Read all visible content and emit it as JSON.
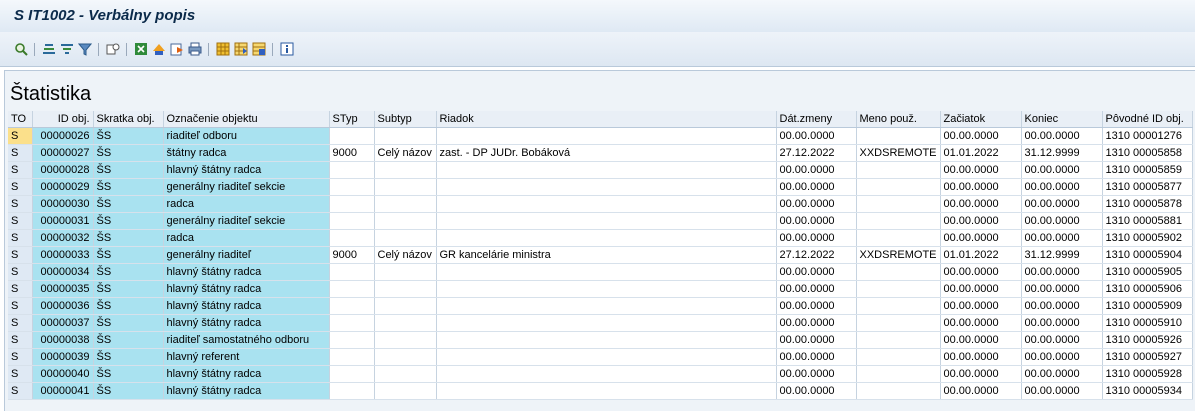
{
  "window": {
    "title": "S IT1002 - Verbálny popis"
  },
  "toolbar": {
    "icons": [
      "details-icon",
      "sort-ascending-icon",
      "filter-icon",
      "filter-off-icon",
      "total-icon",
      "excel-export-icon",
      "transport-icon",
      "save-file-icon",
      "print-icon",
      "layout-icon",
      "change-layout-icon",
      "save-layout-icon",
      "info-icon"
    ]
  },
  "panel": {
    "title": "Štatistika"
  },
  "table": {
    "headers": {
      "to": "TO",
      "id": "ID obj.",
      "abbr": "Skratka obj.",
      "name": "Označenie objektu",
      "styp": "STyp",
      "subtyp": "Subtyp",
      "riadok": "Riadok",
      "dat": "Dát.zmeny",
      "user": "Meno použ.",
      "start": "Začiatok",
      "end": "Koniec",
      "orig": "Pôvodné ID obj."
    },
    "rows": [
      {
        "to": "S",
        "id": "00000026",
        "abbr": "ŠS",
        "name": "riaditeľ odboru",
        "styp": "",
        "subtyp": "",
        "riadok": "",
        "dat": "00.00.0000",
        "user": "",
        "start": "00.00.0000",
        "end": "00.00.0000",
        "orig": "1310 00001276"
      },
      {
        "to": "S",
        "id": "00000027",
        "abbr": "ŠS",
        "name": "štátny radca",
        "styp": "9000",
        "subtyp": "Celý názov",
        "riadok": "zast. - DP JUDr. Bobáková",
        "dat": "27.12.2022",
        "user": "XXDSREMOTE",
        "start": "01.01.2022",
        "end": "31.12.9999",
        "orig": "1310 00005858"
      },
      {
        "to": "S",
        "id": "00000028",
        "abbr": "ŠS",
        "name": "hlavný štátny radca",
        "styp": "",
        "subtyp": "",
        "riadok": "",
        "dat": "00.00.0000",
        "user": "",
        "start": "00.00.0000",
        "end": "00.00.0000",
        "orig": "1310 00005859"
      },
      {
        "to": "S",
        "id": "00000029",
        "abbr": "ŠS",
        "name": "generálny riaditeľ sekcie",
        "styp": "",
        "subtyp": "",
        "riadok": "",
        "dat": "00.00.0000",
        "user": "",
        "start": "00.00.0000",
        "end": "00.00.0000",
        "orig": "1310 00005877"
      },
      {
        "to": "S",
        "id": "00000030",
        "abbr": "ŠS",
        "name": "radca",
        "styp": "",
        "subtyp": "",
        "riadok": "",
        "dat": "00.00.0000",
        "user": "",
        "start": "00.00.0000",
        "end": "00.00.0000",
        "orig": "1310 00005878"
      },
      {
        "to": "S",
        "id": "00000031",
        "abbr": "ŠS",
        "name": "generálny riaditeľ sekcie",
        "styp": "",
        "subtyp": "",
        "riadok": "",
        "dat": "00.00.0000",
        "user": "",
        "start": "00.00.0000",
        "end": "00.00.0000",
        "orig": "1310 00005881"
      },
      {
        "to": "S",
        "id": "00000032",
        "abbr": "ŠS",
        "name": "radca",
        "styp": "",
        "subtyp": "",
        "riadok": "",
        "dat": "00.00.0000",
        "user": "",
        "start": "00.00.0000",
        "end": "00.00.0000",
        "orig": "1310 00005902"
      },
      {
        "to": "S",
        "id": "00000033",
        "abbr": "ŠS",
        "name": "generálny riaditeľ",
        "styp": "9000",
        "subtyp": "Celý názov",
        "riadok": "GR kancelárie ministra",
        "dat": "27.12.2022",
        "user": "XXDSREMOTE",
        "start": "01.01.2022",
        "end": "31.12.9999",
        "orig": "1310 00005904"
      },
      {
        "to": "S",
        "id": "00000034",
        "abbr": "ŠS",
        "name": "hlavný štátny radca",
        "styp": "",
        "subtyp": "",
        "riadok": "",
        "dat": "00.00.0000",
        "user": "",
        "start": "00.00.0000",
        "end": "00.00.0000",
        "orig": "1310 00005905"
      },
      {
        "to": "S",
        "id": "00000035",
        "abbr": "ŠS",
        "name": "hlavný štátny radca",
        "styp": "",
        "subtyp": "",
        "riadok": "",
        "dat": "00.00.0000",
        "user": "",
        "start": "00.00.0000",
        "end": "00.00.0000",
        "orig": "1310 00005906"
      },
      {
        "to": "S",
        "id": "00000036",
        "abbr": "ŠS",
        "name": "hlavný štátny radca",
        "styp": "",
        "subtyp": "",
        "riadok": "",
        "dat": "00.00.0000",
        "user": "",
        "start": "00.00.0000",
        "end": "00.00.0000",
        "orig": "1310 00005909"
      },
      {
        "to": "S",
        "id": "00000037",
        "abbr": "ŠS",
        "name": "hlavný štátny radca",
        "styp": "",
        "subtyp": "",
        "riadok": "",
        "dat": "00.00.0000",
        "user": "",
        "start": "00.00.0000",
        "end": "00.00.0000",
        "orig": "1310 00005910"
      },
      {
        "to": "S",
        "id": "00000038",
        "abbr": "ŠS",
        "name": "riaditeľ samostatného odboru",
        "styp": "",
        "subtyp": "",
        "riadok": "",
        "dat": "00.00.0000",
        "user": "",
        "start": "00.00.0000",
        "end": "00.00.0000",
        "orig": "1310 00005926"
      },
      {
        "to": "S",
        "id": "00000039",
        "abbr": "ŠS",
        "name": "hlavný referent",
        "styp": "",
        "subtyp": "",
        "riadok": "",
        "dat": "00.00.0000",
        "user": "",
        "start": "00.00.0000",
        "end": "00.00.0000",
        "orig": "1310 00005927"
      },
      {
        "to": "S",
        "id": "00000040",
        "abbr": "ŠS",
        "name": "hlavný štátny radca",
        "styp": "",
        "subtyp": "",
        "riadok": "",
        "dat": "00.00.0000",
        "user": "",
        "start": "00.00.0000",
        "end": "00.00.0000",
        "orig": "1310 00005928"
      },
      {
        "to": "S",
        "id": "00000041",
        "abbr": "ŠS",
        "name": "hlavný štátny radca",
        "styp": "",
        "subtyp": "",
        "riadok": "",
        "dat": "00.00.0000",
        "user": "",
        "start": "00.00.0000",
        "end": "00.00.0000",
        "orig": "1310 00005934"
      }
    ]
  }
}
